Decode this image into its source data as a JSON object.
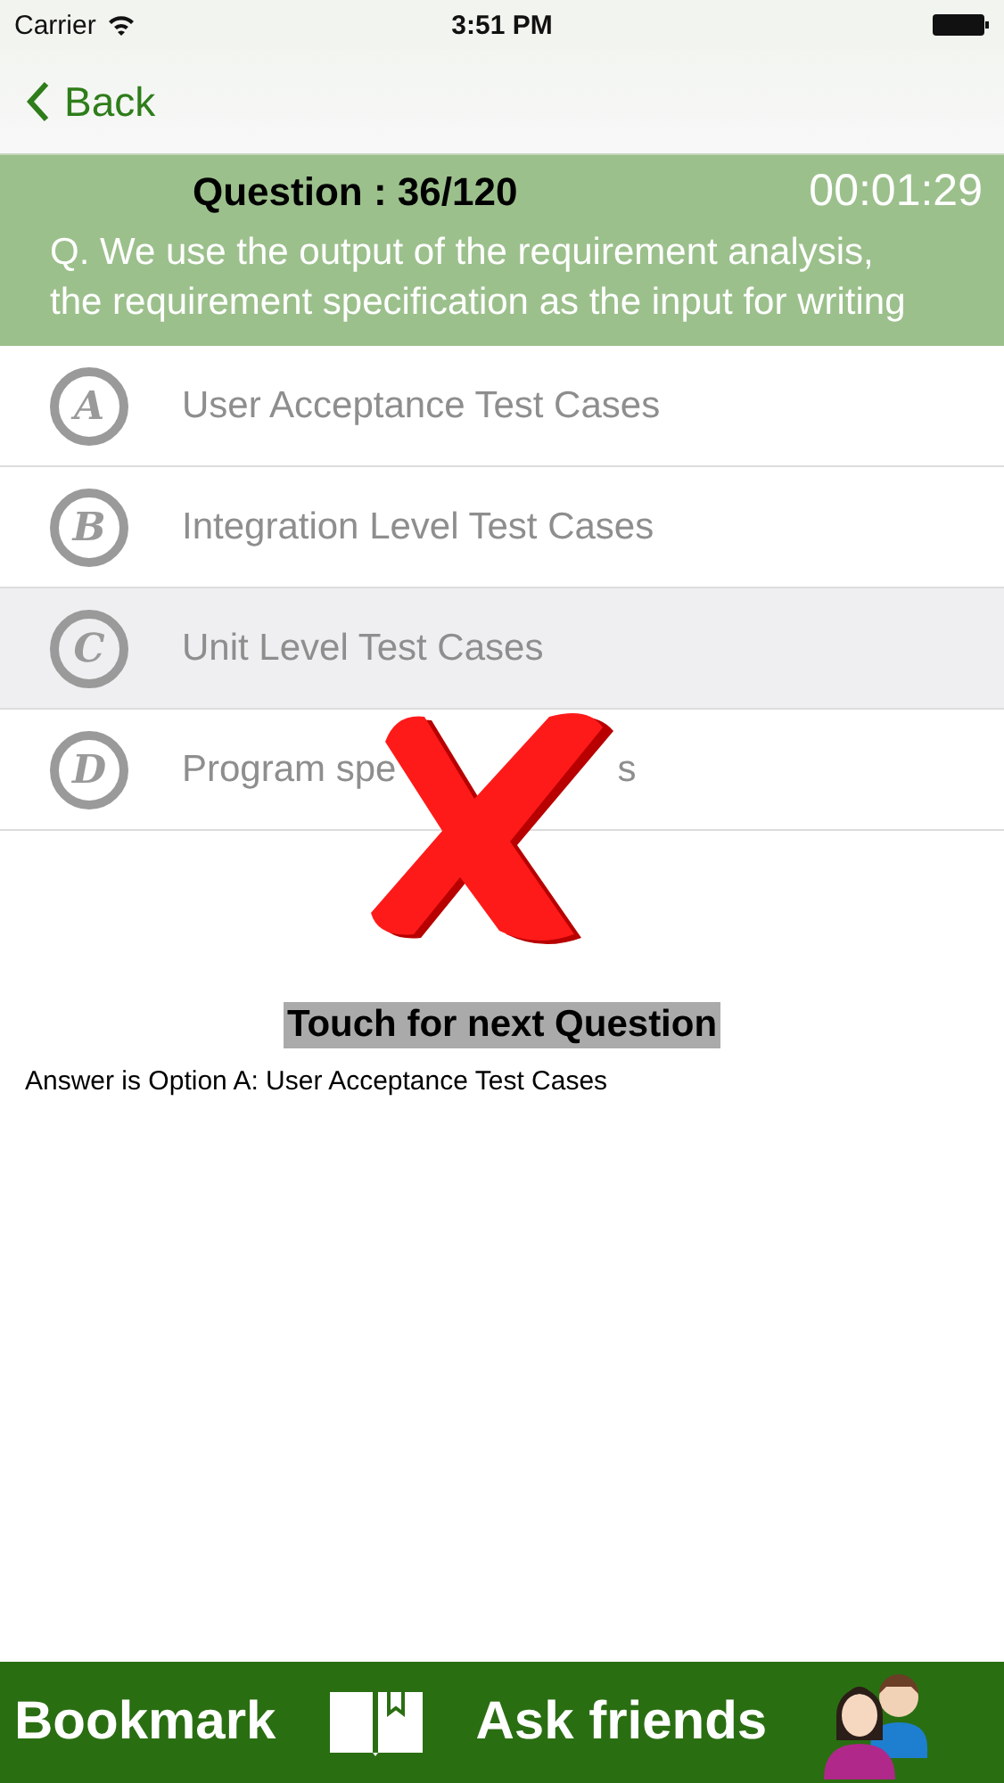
{
  "status_bar": {
    "carrier": "Carrier",
    "time": "3:51 PM"
  },
  "nav": {
    "back": "Back"
  },
  "question": {
    "number": "Question : 36/120",
    "timer": "00:01:29",
    "text": "Q. We use the output of the requirement analysis, the requirement specification as the input for writing"
  },
  "options": [
    {
      "letter": "A",
      "label": "User Acceptance Test Cases",
      "selected": false
    },
    {
      "letter": "B",
      "label": "Integration Level Test Cases",
      "selected": false
    },
    {
      "letter": "C",
      "label": "Unit Level Test Cases",
      "selected": true
    },
    {
      "letter": "D",
      "label": "Program spe",
      "label_tail": "s",
      "selected": false
    }
  ],
  "result": {
    "kind": "wrong"
  },
  "next_button": "Touch for next Question",
  "answer": "Answer is Option A: User Acceptance Test Cases",
  "bottom_bar": {
    "bookmark": "Bookmark",
    "ask": "Ask friends"
  }
}
